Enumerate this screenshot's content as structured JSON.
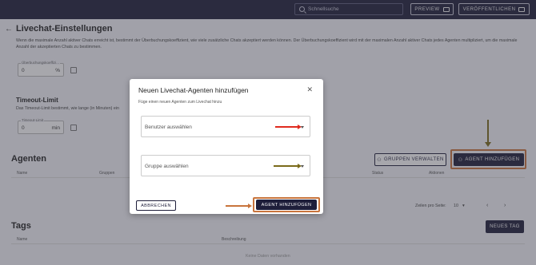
{
  "topbar": {
    "search_placeholder": "Schnellsuche",
    "preview_label": "PREVIEW",
    "publish_label": "VERÖFFENTLICHEN"
  },
  "page": {
    "title": "Livechat-Einstellungen",
    "overbooking_description": "Wenn die maximale Anzahl aktiver Chats erreicht ist, bestimmt der Überbuchungskoeffizient, wie viele zusätzliche Chats akzeptiert werden können. Der Überbuchungskoeffizient wird mit der maximalen Anzahl aktiver Chats jedes Agenten multipliziert, um die maximale Anzahl der akzeptierten Chats zu bestimmen.",
    "overbooking_field": {
      "label": "Überbuchungskoeffizi...",
      "value": "0",
      "unit": "%"
    },
    "timeout_title": "Timeout-Limit",
    "timeout_description": "Das Timeout-Limit bestimmt, wie lange (in Minuten) ein",
    "timeout_field": {
      "label": "Timeout-Limit",
      "value": "0",
      "unit": "min"
    }
  },
  "agents": {
    "title": "Agenten",
    "manage_groups_label": "GRUPPEN VERWALTEN",
    "add_agent_label": "AGENT HINZUFÜGEN",
    "columns": [
      "Name",
      "Gruppen",
      "Status",
      "Aktionen"
    ],
    "rows_per_page_label": "Zeilen pro Seite:",
    "rows_per_page_value": "10"
  },
  "tags": {
    "title": "Tags",
    "new_tag_label": "NEUES TAG",
    "columns": [
      "Name",
      "Beschreibung"
    ],
    "empty_text": "Keine Daten vorhanden"
  },
  "modal": {
    "title": "Neuen Livechat-Agenten hinzufügen",
    "subtitle": "Füge einen neuen Agenten zum Livechat hinzu",
    "user_placeholder": "Benutzer auswählen",
    "group_placeholder": "Gruppe auswählen",
    "cancel_label": "ABBRECHEN",
    "submit_label": "AGENT HINZUFÜGEN"
  },
  "colors": {
    "topbar": "#1e1e3a",
    "primary": "#1e1e3a",
    "annotation_red": "#e02a1e",
    "annotation_olive": "#7a6a1a",
    "annotation_brown": "#c8743c"
  }
}
